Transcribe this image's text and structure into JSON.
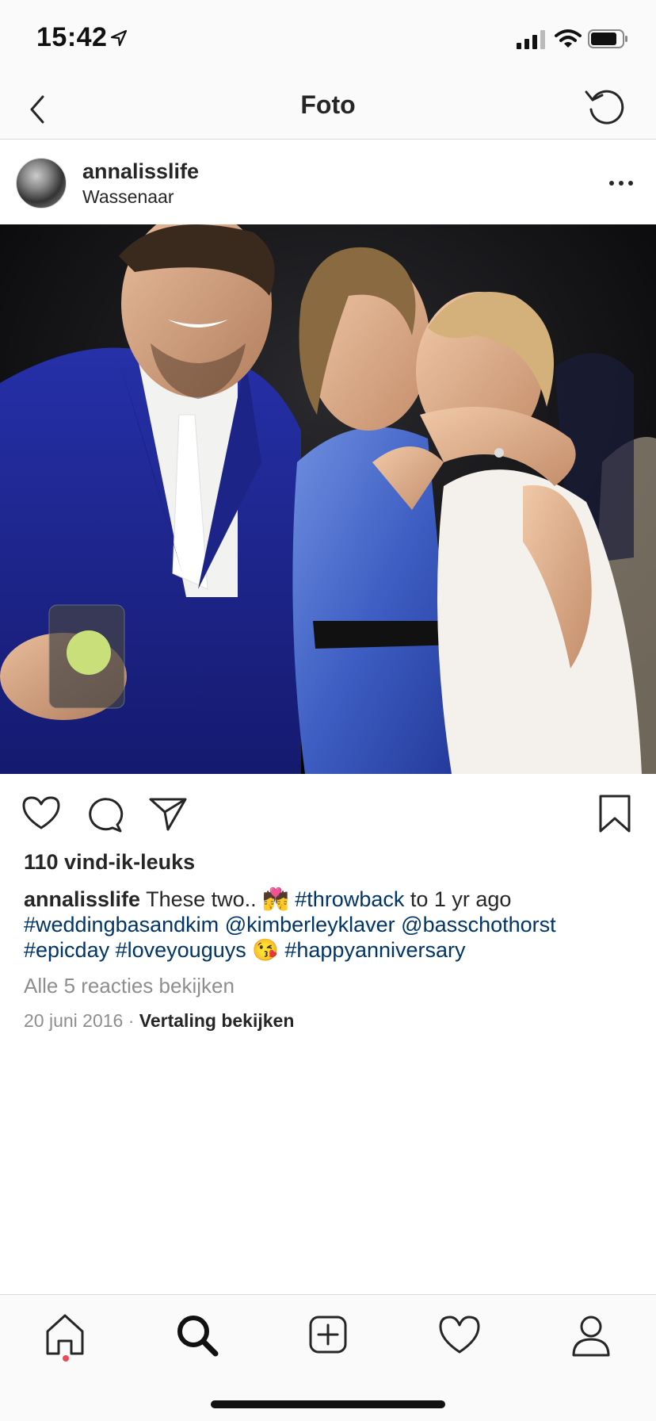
{
  "status_bar": {
    "time": "15:42"
  },
  "nav": {
    "title": "Foto"
  },
  "post": {
    "username": "annalisslife",
    "location": "Wassenaar"
  },
  "likes": "110 vind-ik-leuks",
  "caption": {
    "username": "annalisslife",
    "text_1": " These two.. 💏 ",
    "tag_throwback": "#throwback",
    "text_2": " to 1 yr ago ",
    "tag_wedding": "#weddingbasandkim",
    "mention_1": "@kimberleyklaver",
    "mention_2": "@basschothorst",
    "tag_epicday": "#epicday",
    "tag_loveyouguys": "#loveyouguys",
    "emoji_kiss": " 😘 ",
    "tag_anniversary": "#happyanniversary"
  },
  "comments_link": "Alle 5 reacties bekijken",
  "date": "20 juni 2016",
  "date_separator": " · ",
  "translate_link": "Vertaling bekijken",
  "icons": {
    "nav": [
      "back-icon",
      "refresh-icon"
    ],
    "actions": [
      "heart-icon",
      "comment-icon",
      "share-icon",
      "bookmark-icon"
    ],
    "tabs": [
      "home-icon",
      "search-icon",
      "add-icon",
      "activity-icon",
      "profile-icon"
    ]
  },
  "colors": {
    "hashtag": "#003569",
    "notification_dot": "#ed4956",
    "text": "#262626",
    "muted": "#8e8e8e"
  }
}
